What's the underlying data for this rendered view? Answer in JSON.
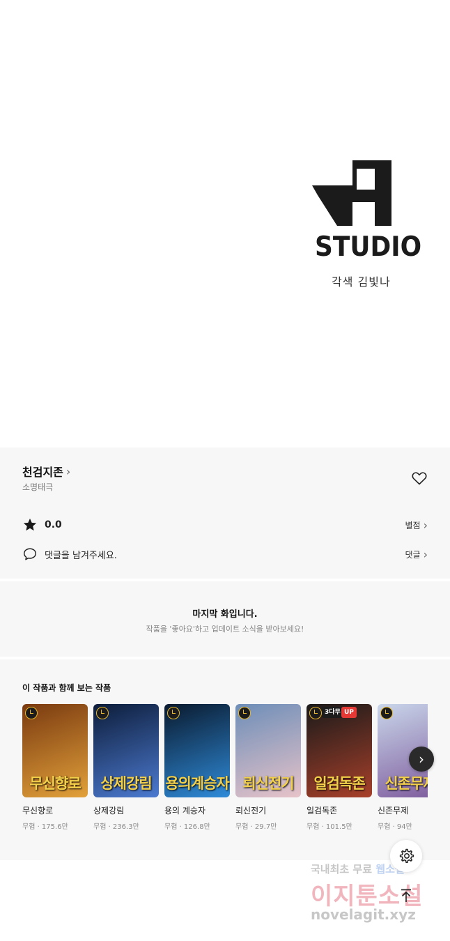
{
  "studio": {
    "logo_word": "STUDIO",
    "credit": "각색 김빛나"
  },
  "work": {
    "title": "천검지존",
    "author": "소명태극",
    "rating": "0.0",
    "rating_link": "별점",
    "comment_prompt": "댓글을 남겨주세요.",
    "comment_link": "댓글"
  },
  "last_episode": {
    "heading": "마지막 화입니다.",
    "subtext": "작품을 '좋아요'하고 업데이트 소식을 받아보세요!"
  },
  "recommend": {
    "heading": "이 작품과 함께 보는 작품",
    "items": [
      {
        "title": "무신향로",
        "meta": "무협 · 175.6만",
        "cover_text": "무신향로",
        "cover_from": "#7a3a10",
        "cover_to": "#e2a13a"
      },
      {
        "title": "상제강림",
        "meta": "무협 · 236.3만",
        "cover_text": "상제강림",
        "cover_from": "#0d1d3a",
        "cover_to": "#4c7ad0"
      },
      {
        "title": "용의 계승자",
        "meta": "무협 · 126.8만",
        "cover_text": "용의계승자",
        "cover_from": "#0a1a2e",
        "cover_to": "#2f8bd9"
      },
      {
        "title": "뢰신전기",
        "meta": "무협 · 29.7만",
        "cover_text": "뢰신전기",
        "cover_from": "#6d8eb8",
        "cover_to": "#e7c3c9"
      },
      {
        "title": "일검독존",
        "meta": "무협 · 101.5만",
        "cover_text": "일검독존",
        "cover_from": "#1a1a1a",
        "cover_to": "#a8402a",
        "badge_wait": "3다무",
        "badge_up": "UP"
      },
      {
        "title": "신존무제",
        "meta": "무협 · 94만",
        "cover_text": "신존무제",
        "cover_from": "#c9d6ea",
        "cover_to": "#7d5a9c"
      }
    ]
  },
  "watermark": {
    "line1_a": "국내최초 무료",
    "line1_b": "웹소설",
    "line2": "이지툰소설",
    "line3": "novelagit.xyz"
  },
  "icons": {
    "heart": "heart-icon",
    "star": "star-icon",
    "comment": "comment-icon",
    "next": "chevron-right-icon",
    "gear": "gear-icon",
    "top": "arrow-up-icon"
  }
}
